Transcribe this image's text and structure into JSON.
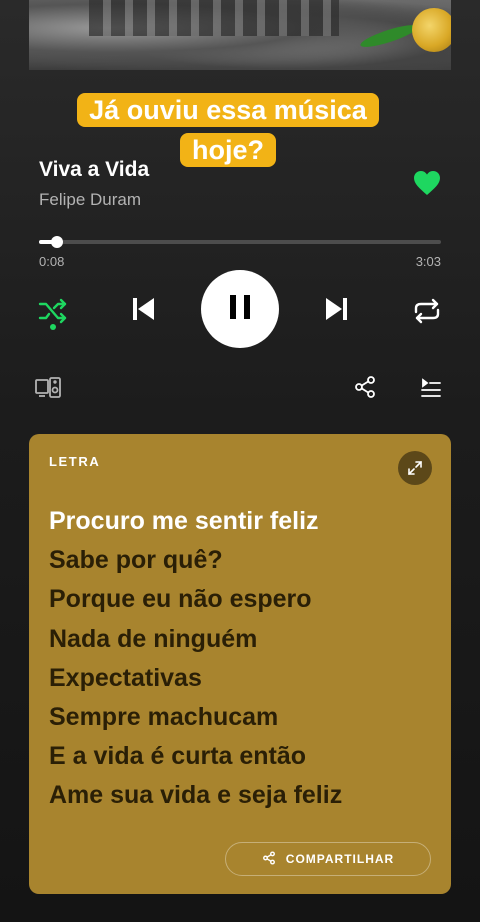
{
  "overlay_caption": "Já ouviu essa música hoje?",
  "track": {
    "title": "Viva a Vida",
    "artist": "Felipe Duram",
    "liked": true
  },
  "playback": {
    "elapsed": "0:08",
    "duration": "3:03",
    "progress_fraction": 0.044,
    "shuffle_on": true,
    "is_playing": true
  },
  "colors": {
    "accent_green": "#1ed760",
    "caption_bg": "#f2b316",
    "lyrics_card_bg": "#a8842e",
    "lyric_inactive": "#2a1f06",
    "lyric_active": "#ffffff"
  },
  "icons": {
    "shuffle": "shuffle-icon",
    "previous": "skip-previous-icon",
    "play_pause": "pause-icon",
    "next": "skip-next-icon",
    "repeat": "repeat-icon",
    "devices": "connect-devices-icon",
    "share": "share-icon",
    "queue": "queue-icon",
    "like": "heart-icon",
    "expand": "expand-icon"
  },
  "lyrics": {
    "header": "LETRA",
    "lines": [
      "Procuro me sentir feliz",
      "Sabe por quê?",
      "Porque eu não espero",
      "Nada de ninguém",
      "Expectativas",
      "Sempre machucam",
      "E a vida é curta então",
      "Ame sua vida e seja feliz"
    ],
    "active_line_index": 0,
    "share_label": "COMPARTILHAR"
  }
}
